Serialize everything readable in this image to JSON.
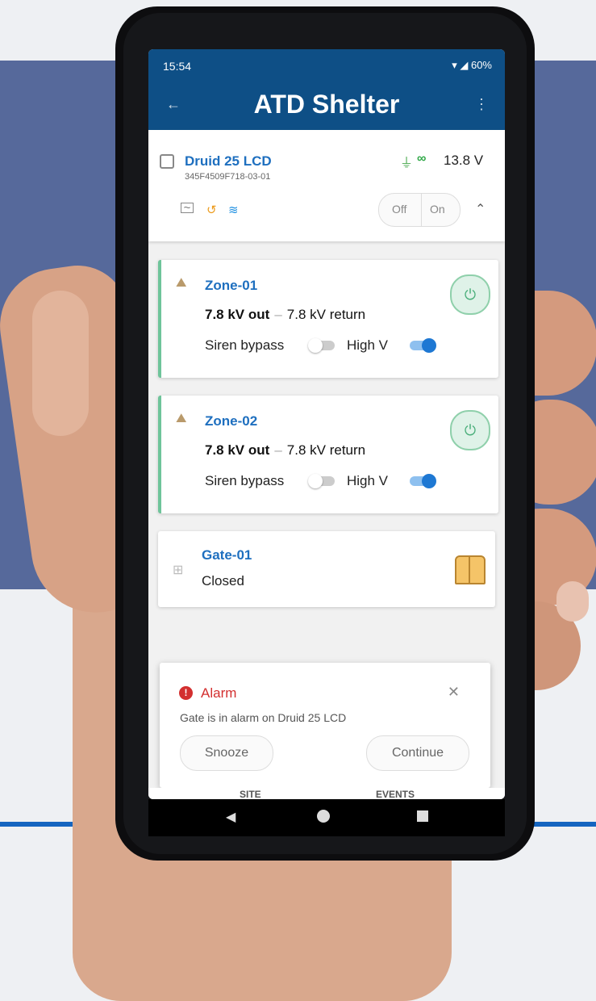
{
  "status": {
    "time": "15:54",
    "indicators": "60%"
  },
  "appbar": {
    "title": "ATD Shelter",
    "back_icon": "arrow-left-icon",
    "menu_icon": "more-vert-icon"
  },
  "device": {
    "name": "Druid 25 LCD",
    "serial": "345F4509F718-03-01",
    "voltage": "13.8 V",
    "off_label": "Off",
    "on_label": "On"
  },
  "zones": [
    {
      "name": "Zone-01",
      "out": "7.8 kV out",
      "return": "7.8 kV return",
      "siren_label": "Siren bypass",
      "siren_on": false,
      "highv_label": "High V",
      "highv_on": true
    },
    {
      "name": "Zone-02",
      "out": "7.8 kV out",
      "return": "7.8 kV return",
      "siren_label": "Siren bypass",
      "siren_on": false,
      "highv_label": "High V",
      "highv_on": true
    }
  ],
  "gate": {
    "name": "Gate-01",
    "state": "Closed"
  },
  "alarm": {
    "title": "Alarm",
    "message": "Gate is in alarm on Druid 25 LCD",
    "snooze_label": "Snooze",
    "continue_label": "Continue"
  },
  "bottom_tabs": [
    "SITE",
    "EVENTS"
  ],
  "colors": {
    "appbar": "#0e4f86",
    "link": "#1e6fbf",
    "zone_accent": "#6ec49a",
    "alarm": "#d32f2f",
    "background_panel": "#56699b"
  }
}
